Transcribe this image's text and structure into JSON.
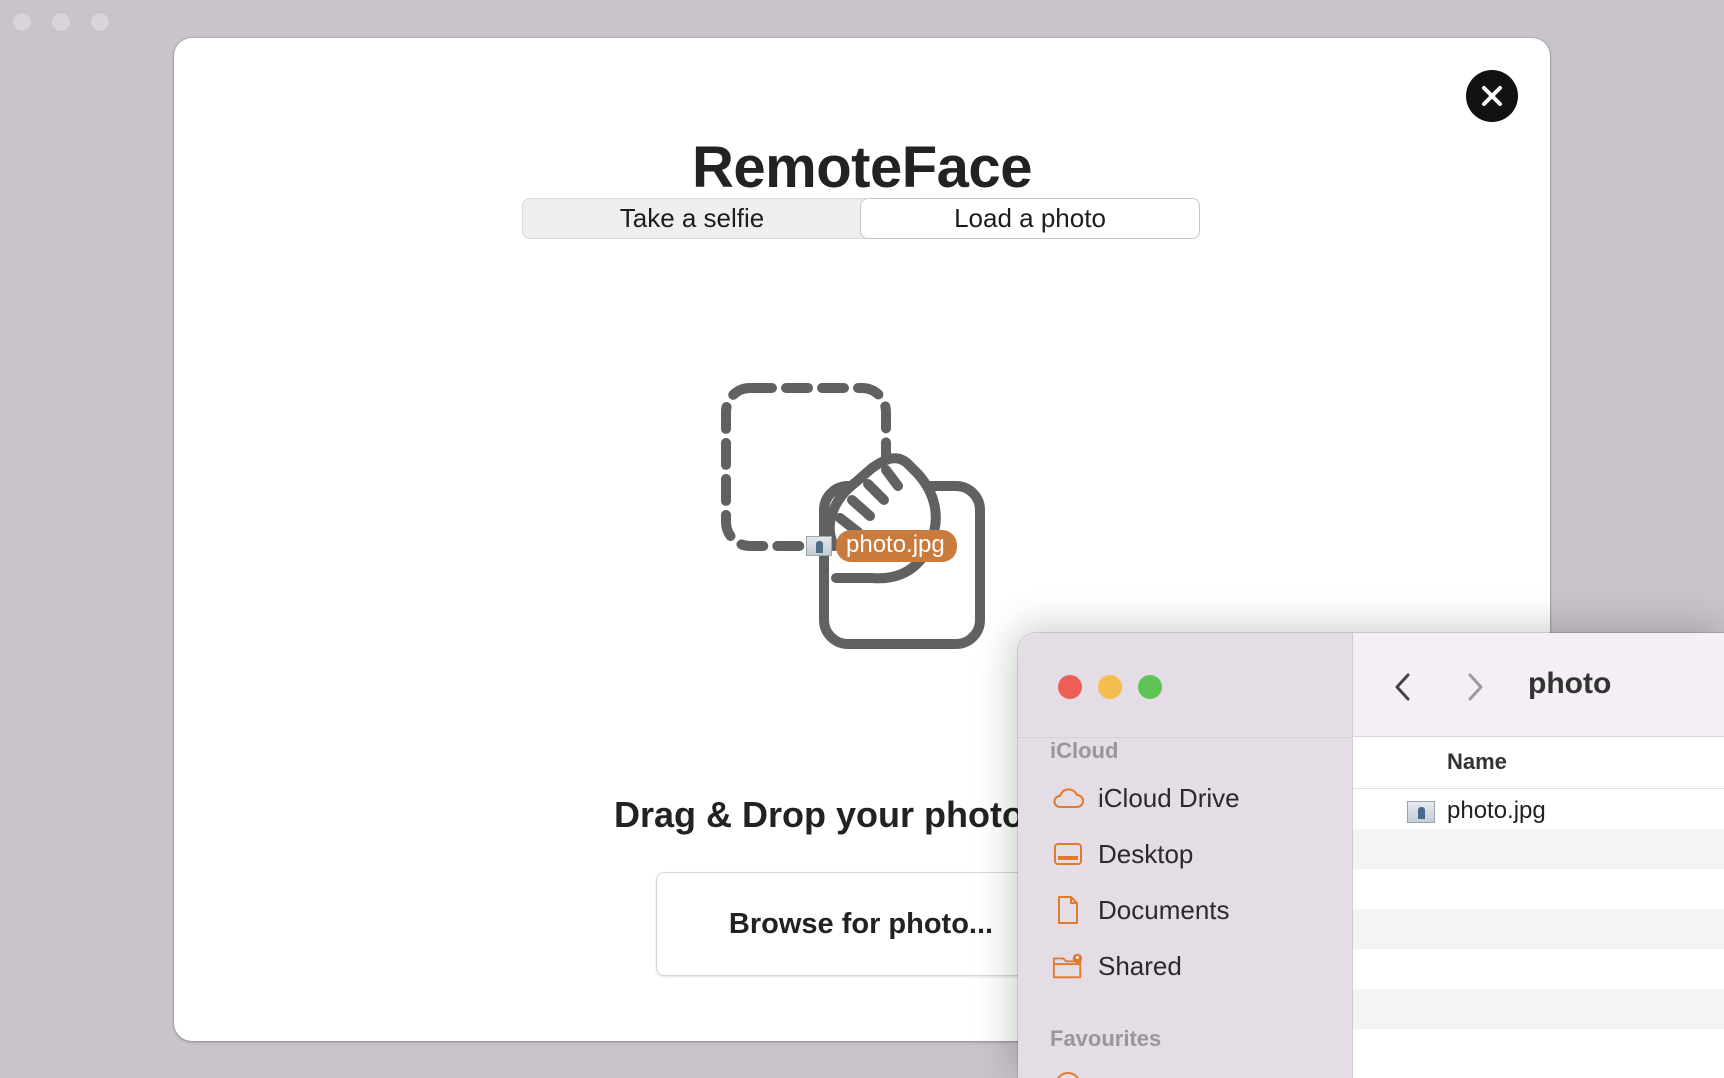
{
  "app": {
    "title": "RemoteFace",
    "tabs": [
      {
        "label": "Take a selfie",
        "active": false
      },
      {
        "label": "Load a photo",
        "active": true
      }
    ],
    "drag_file_label": "photo.jpg",
    "drop_prompt": "Drag & Drop your photo",
    "browse_button": "Browse for photo..."
  },
  "finder": {
    "folder_title": "photo",
    "sidebar": {
      "sections": [
        {
          "label": "iCloud",
          "items": [
            {
              "label": "iCloud Drive",
              "icon": "cloud-icon"
            },
            {
              "label": "Desktop",
              "icon": "desktop-icon"
            },
            {
              "label": "Documents",
              "icon": "document-icon"
            },
            {
              "label": "Shared",
              "icon": "shared-folder-icon"
            }
          ]
        },
        {
          "label": "Favourites",
          "items": []
        }
      ]
    },
    "columns": [
      "Name"
    ],
    "files": [
      {
        "name": "photo.jpg",
        "icon": "image-file-icon"
      }
    ]
  },
  "colors": {
    "accent_orange": "#c97a3d",
    "sidebar_icon": "#e07b2e",
    "traffic_close": "#ec5f57",
    "traffic_minimize": "#f4bd4f",
    "traffic_zoom": "#5fc454"
  }
}
